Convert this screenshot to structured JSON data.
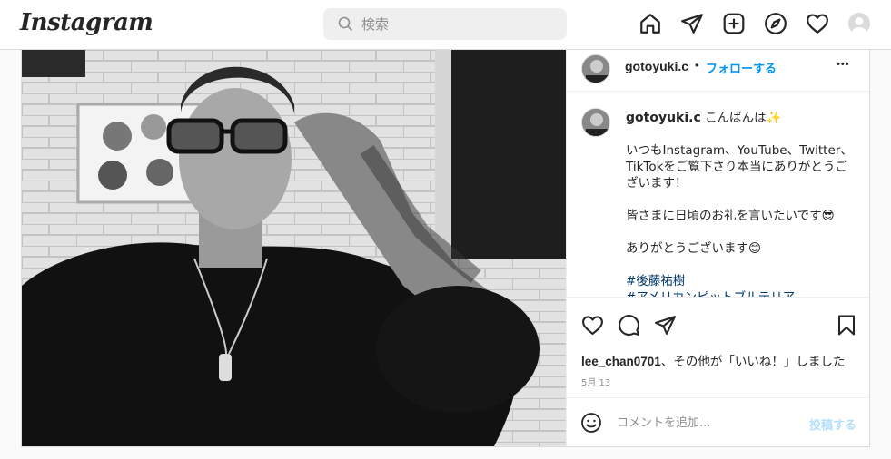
{
  "header": {
    "logo": "Instagram",
    "search_placeholder": "検索",
    "icons": [
      "home-icon",
      "send-icon",
      "new-post-icon",
      "explore-icon",
      "heart-icon",
      "profile-avatar"
    ]
  },
  "post": {
    "username": "gotoyuki.c",
    "separator": "•",
    "follow_label": "フォローする",
    "more": "•••",
    "caption": {
      "username": "gotoyuki.c",
      "first_line": "こんばんは✨",
      "lines": [
        "いつもInstagram、YouTube、Twitter、TikTokをご覧下さり本当にありがとうございます！",
        "皆さまに日頃のお礼を言いたいです😎",
        "ありがとうございます😊"
      ],
      "hashtags": [
        "#後藤祐樹",
        "#アメリカンピットブルテリア"
      ]
    },
    "likes": {
      "user": "lee_chan0701",
      "rest": "、その他が「いいね！」しました"
    },
    "date": "5月 13",
    "comment_placeholder": "コメントを追加...",
    "post_button": "投稿する"
  },
  "colors": {
    "accent": "#0095f6",
    "hashtag": "#00376b",
    "border": "#dbdbdb"
  }
}
